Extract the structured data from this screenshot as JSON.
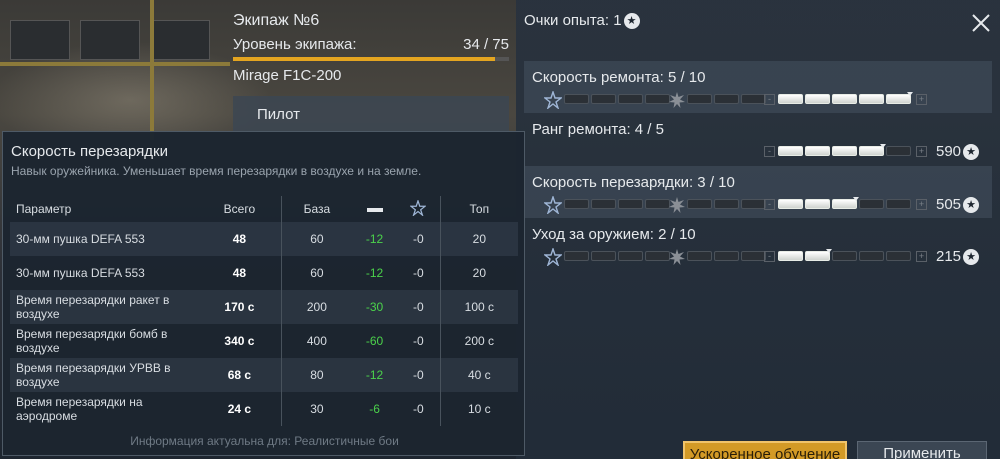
{
  "crew": {
    "title": "Экипаж №6",
    "level_label": "Уровень экипажа:",
    "level_value": "34 / 75",
    "progress": 0.95,
    "vehicle": "Mirage F1C-200",
    "role_tab": "Пилот"
  },
  "xp": {
    "label": "Очки опыта: 1",
    "icon": "star-circle-icon"
  },
  "skills": [
    {
      "label": "Скорость ремонта: 5 / 10",
      "left_on": 0,
      "mid_on": 0,
      "right_on": 5,
      "cost": ""
    },
    {
      "label": "Ранг ремонта: 4 / 5",
      "right_on": 4,
      "cost": "590"
    },
    {
      "label": "Скорость перезарядки: 3 / 10",
      "left_on": 0,
      "mid_on": 0,
      "right_on": 3,
      "cost": "505"
    },
    {
      "label": "Уход за оружием: 2 / 10",
      "left_on": 0,
      "mid_on": 0,
      "right_on": 2,
      "cost": "215"
    }
  ],
  "buttons": {
    "accelerated": "Ускоренное обучение",
    "apply": "Применить"
  },
  "tooltip": {
    "title": "Скорость перезарядки",
    "description": "Навык оружейника. Уменьшает время перезарядки в воздухе и на земле.",
    "headers": {
      "param": "Параметр",
      "total": "Всего",
      "base": "База",
      "top": "Топ"
    },
    "rows": [
      {
        "param": "30-мм пушка DEFA 553",
        "total": "48",
        "base": "60",
        "bonus": "-12",
        "expert": "-0",
        "top": "20"
      },
      {
        "param": "30-мм пушка DEFA 553",
        "total": "48",
        "base": "60",
        "bonus": "-12",
        "expert": "-0",
        "top": "20"
      },
      {
        "param": "Время перезарядки ракет в воздухе",
        "total": "170 с",
        "base": "200",
        "bonus": "-30",
        "expert": "-0",
        "top": "100 с"
      },
      {
        "param": "Время перезарядки бомб в воздухе",
        "total": "340 с",
        "base": "400",
        "bonus": "-60",
        "expert": "-0",
        "top": "200 с"
      },
      {
        "param": "Время перезарядки УРВВ в воздухе",
        "total": "68 с",
        "base": "80",
        "bonus": "-12",
        "expert": "-0",
        "top": "40 с"
      },
      {
        "param": "Время перезарядки на аэродроме",
        "total": "24 с",
        "base": "30",
        "bonus": "-6",
        "expert": "-0",
        "top": "10 с"
      }
    ],
    "footer": "Информация актуальна для: Реалистичные бои"
  },
  "colors": {
    "accent": "#e4a520",
    "bonus_green": "#4bd24b",
    "button_gold": "#d39a26"
  }
}
